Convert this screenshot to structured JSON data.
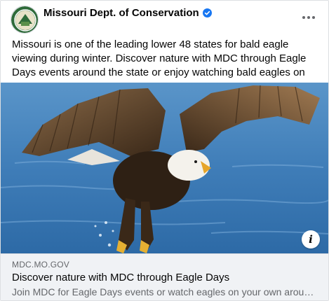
{
  "post": {
    "page_name": "Missouri Dept. of Conservation",
    "verified": true,
    "body_text": "Missouri is one of the leading lower 48 states for bald eagle viewing during winter. Discover nature with MDC through Eagle Days events around the state or enjoy watching bald eagles on your own."
  },
  "link_preview": {
    "domain": "MDC.MO.GOV",
    "title": "Discover nature with MDC through Eagle Days",
    "description": "Join MDC for Eagle Days events or watch eagles on your own around the state."
  },
  "icons": {
    "more": "more-options-icon",
    "verified": "verified-badge-icon",
    "info": "info-icon"
  },
  "colors": {
    "verified_blue": "#1877f2",
    "link_bg": "#f0f2f5",
    "secondary_text": "#65676b",
    "water": "#3f7db8"
  }
}
